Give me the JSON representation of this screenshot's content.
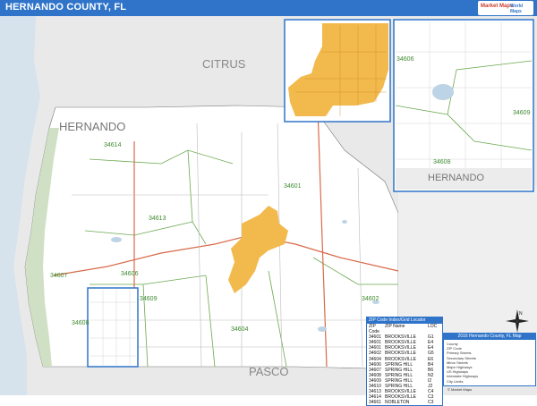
{
  "title": "HERNANDO COUNTY, FL",
  "brand": {
    "line1": "Market Maps",
    "line2": "World Maps"
  },
  "map": {
    "colors": {
      "water": "#d6e3ec",
      "land": "#ffffff",
      "neighbor": "#e8e8e8",
      "city": "#f2b94c",
      "road_major": "#d86a4a",
      "zip_boundary": "#6aa84f",
      "zip_label": "#3c8a2e"
    },
    "county_labels": [
      "CITRUS",
      "HERNANDO",
      "PASCO"
    ],
    "zip_labels": [
      "34614",
      "34613",
      "34601",
      "34607",
      "34608",
      "34609",
      "34606",
      "34604",
      "34602"
    ],
    "inset_labels": {
      "zips": [
        "34606",
        "34609",
        "34608"
      ],
      "county": "HERNANDO"
    }
  },
  "zip_table": {
    "title": "ZIP Code Index/Grid Locator",
    "headers": [
      "ZIP Code",
      "ZIP Name",
      "LOC"
    ],
    "rows": [
      [
        "34601",
        "BROOKSVILLE",
        "G1"
      ],
      [
        "34601",
        "BROOKSVILLE",
        "E4"
      ],
      [
        "34601",
        "BROOKSVILLE",
        "E4"
      ],
      [
        "34602",
        "BROOKSVILLE",
        "G5"
      ],
      [
        "34604",
        "BROOKSVILLE",
        "E6"
      ],
      [
        "34606",
        "SPRING HILL",
        "B4"
      ],
      [
        "34607",
        "SPRING HILL",
        "B6"
      ],
      [
        "34608",
        "SPRING HILL",
        "N2"
      ],
      [
        "34609",
        "SPRING HILL",
        "I2"
      ],
      [
        "34610",
        "SPRING HILL",
        "J2"
      ],
      [
        "34613",
        "BROOKSVILLE",
        "C4"
      ],
      [
        "34614",
        "BROOKSVILLE",
        "C3"
      ],
      [
        "34661",
        "NOBLETON",
        "C3"
      ]
    ]
  },
  "legend": {
    "title": "2016 Hernando County, FL Map",
    "items": [
      "County",
      "ZIP Code",
      "Primary Streets",
      "Secondary Streets",
      "Minor Streets",
      "Major Highways",
      "US Highways",
      "Interstate Highways",
      "City Limits"
    ]
  },
  "compass": "N",
  "copyright": "© Market Maps"
}
